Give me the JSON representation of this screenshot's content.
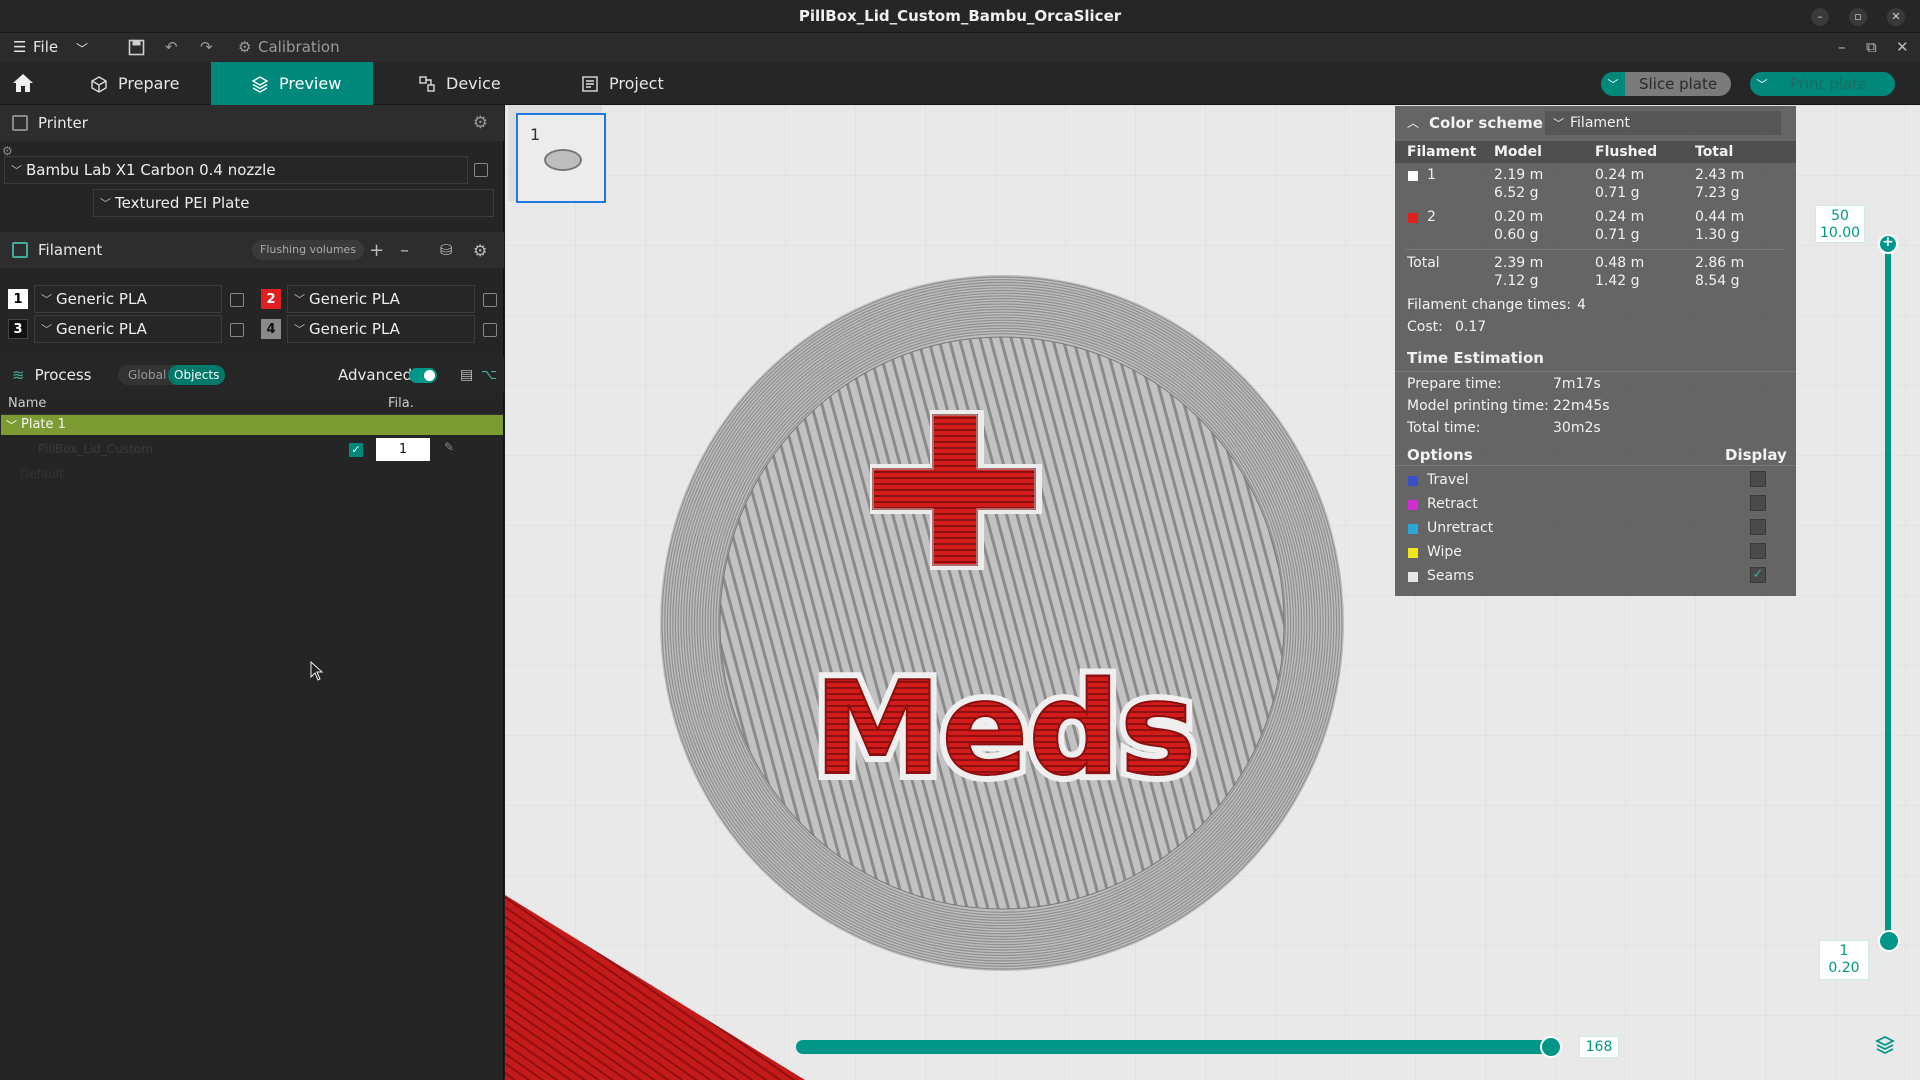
{
  "window": {
    "title": "PillBox_Lid_Custom_Bambu_OrcaSlicer"
  },
  "menubar": {
    "file_label": "File",
    "calibration_label": "Calibration"
  },
  "tabs": {
    "prepare": "Prepare",
    "preview": "Preview",
    "device": "Device",
    "project": "Project"
  },
  "actions": {
    "slice": "Slice plate",
    "print": "Print plate"
  },
  "printer": {
    "section_label": "Printer",
    "name": "Bambu Lab X1 Carbon 0.4 nozzle",
    "plate_type": "Textured PEI Plate"
  },
  "filament": {
    "section_label": "Filament",
    "flushing_label": "Flushing volumes",
    "slots": [
      {
        "num": "1",
        "name": "Generic PLA",
        "color": "#ffffff"
      },
      {
        "num": "2",
        "name": "Generic PLA",
        "color": "#e02020"
      },
      {
        "num": "3",
        "name": "Generic PLA",
        "color": "#111111"
      },
      {
        "num": "4",
        "name": "Generic PLA",
        "color": "#8a8a8a"
      }
    ]
  },
  "process": {
    "section_label": "Process",
    "global_label": "Global",
    "objects_label": "Objects",
    "advanced_label": "Advanced",
    "col_name": "Name",
    "col_fila": "Fila.",
    "plate_row": "Plate 1",
    "object_row": "PillBox_Lid_Custom",
    "object_sub": "Default",
    "object_fila": "1"
  },
  "plate_thumb": {
    "num": "1"
  },
  "legend": {
    "header": "Color scheme",
    "scheme": "Filament",
    "columns": [
      "Filament",
      "Model",
      "Flushed",
      "Total"
    ],
    "rows": [
      {
        "id": "1",
        "color": "#ffffff",
        "model": [
          "2.19 m",
          "6.52 g"
        ],
        "flushed": [
          "0.24 m",
          "0.71 g"
        ],
        "total": [
          "2.43 m",
          "7.23 g"
        ]
      },
      {
        "id": "2",
        "color": "#e02020",
        "model": [
          "0.20 m",
          "0.60 g"
        ],
        "flushed": [
          "0.24 m",
          "0.71 g"
        ],
        "total": [
          "0.44 m",
          "1.30 g"
        ]
      }
    ],
    "total_row": {
      "label": "Total",
      "model": [
        "2.39 m",
        "7.12 g"
      ],
      "flushed": [
        "0.48 m",
        "1.42 g"
      ],
      "total": [
        "2.86 m",
        "8.54 g"
      ]
    },
    "change_times_label": "Filament change times:",
    "change_times": "4",
    "cost_label": "Cost:",
    "cost": "0.17",
    "time_header": "Time Estimation",
    "prepare_label": "Prepare time:",
    "prepare": "7m17s",
    "model_time_label": "Model printing time:",
    "model_time": "22m45s",
    "total_time_label": "Total time:",
    "total_time": "30m2s",
    "options_header": "Options",
    "display_header": "Display",
    "options": [
      {
        "name": "Travel",
        "color": "#3b4fc8",
        "checked": false
      },
      {
        "name": "Retract",
        "color": "#d42cd4",
        "checked": false
      },
      {
        "name": "Unretract",
        "color": "#2aa7d8",
        "checked": false
      },
      {
        "name": "Wipe",
        "color": "#f2e51c",
        "checked": false
      },
      {
        "name": "Seams",
        "color": "#e6e6e6",
        "checked": true
      }
    ]
  },
  "layer_slider": {
    "top_layer": "50",
    "top_height": "10.00",
    "bottom_layer": "1",
    "bottom_height": "0.20"
  },
  "move_slider": {
    "value": "168",
    "fraction": 1.0
  },
  "model_text": "Meds"
}
